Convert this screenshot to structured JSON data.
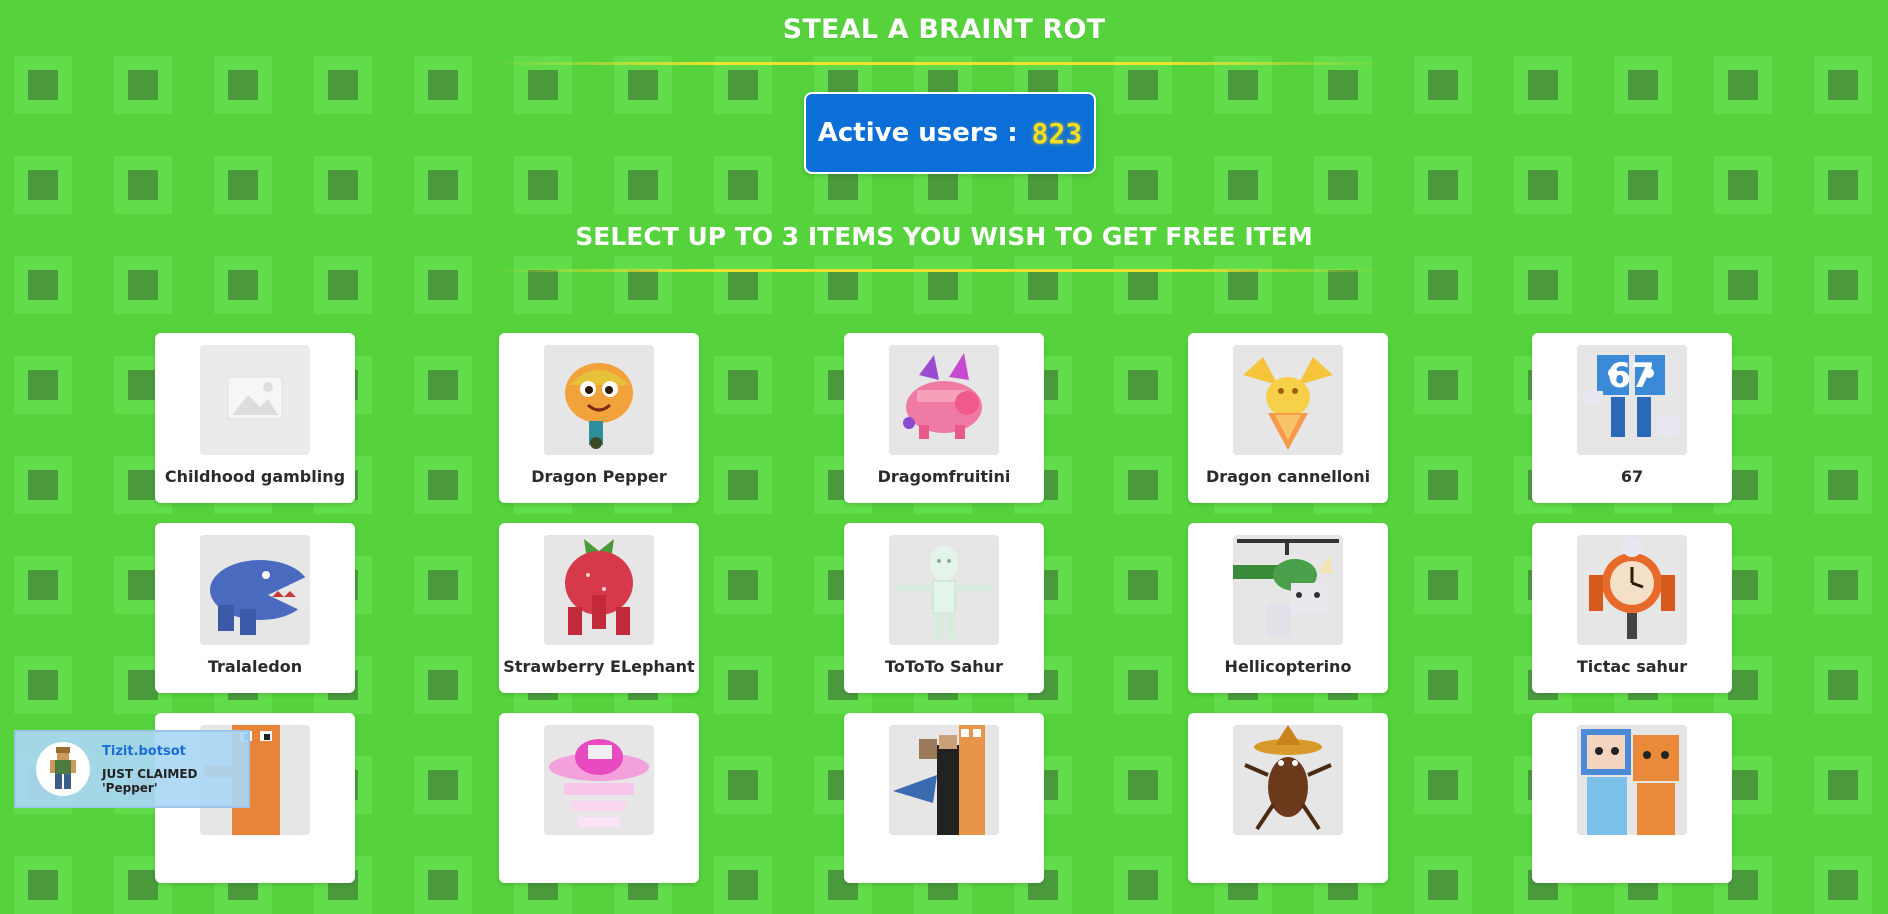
{
  "header": {
    "title": "STEAL A BRAINT ROT",
    "active_label": "Active users :",
    "active_count": "823",
    "subtitle": "SELECT UP TO 3 ITEMS YOU WISH TO GET FREE ITEM"
  },
  "items": [
    {
      "name": "Childhood gambling",
      "icon": "placeholder-image-icon"
    },
    {
      "name": "Dragon Pepper",
      "icon": "taco-character-icon"
    },
    {
      "name": "Dragomfruitini",
      "icon": "pink-dragon-icon"
    },
    {
      "name": "Dragon cannelloni",
      "icon": "golden-dragon-icon"
    },
    {
      "name": "67",
      "icon": "blue-67-character-icon"
    },
    {
      "name": "Tralaledon",
      "icon": "blue-shark-icon"
    },
    {
      "name": "Strawberry ELephant",
      "icon": "strawberry-elephant-icon"
    },
    {
      "name": "ToToTo Sahur",
      "icon": "white-figure-icon"
    },
    {
      "name": "Hellicopterino",
      "icon": "helicopter-icon"
    },
    {
      "name": "Tictac sahur",
      "icon": "clock-character-icon"
    },
    {
      "name": "",
      "icon": "orange-character-icon"
    },
    {
      "name": "",
      "icon": "pink-ufo-icon"
    },
    {
      "name": "",
      "icon": "group-characters-icon"
    },
    {
      "name": "",
      "icon": "cockroach-sombrero-icon"
    },
    {
      "name": "",
      "icon": "duo-characters-icon"
    }
  ],
  "toast": {
    "username": "Tizit.botsot",
    "message": "JUST CLAIMED 'Pepper'",
    "avatar_icon": "roblox-avatar-icon"
  },
  "colors": {
    "background": "#55d23c",
    "pattern_light": "#61dc4a",
    "pattern_dark": "#4a9a3c",
    "active_box": "#0c6fd8",
    "counter": "#f6dd1f",
    "divider": "#f0e12e"
  }
}
